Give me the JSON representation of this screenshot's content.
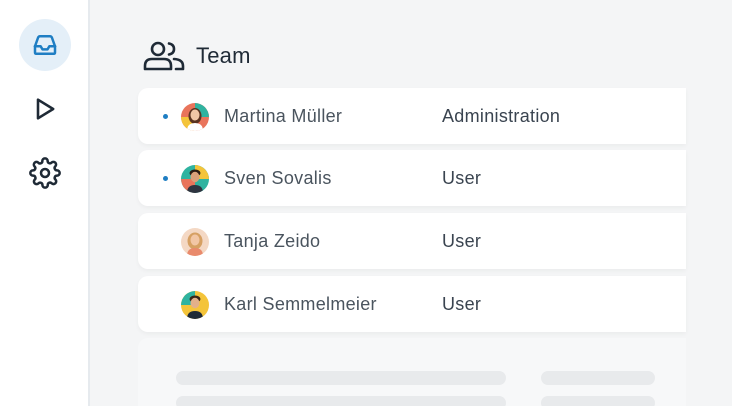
{
  "sidebar": {
    "items": [
      {
        "icon": "inbox-icon",
        "active": true
      },
      {
        "icon": "play-icon",
        "active": false
      },
      {
        "icon": "gear-icon",
        "active": false
      }
    ]
  },
  "header": {
    "title": "Team",
    "icon": "team-icon"
  },
  "members": [
    {
      "name": "Martina Müller",
      "role": "Administration",
      "unread": true
    },
    {
      "name": "Sven Sovalis",
      "role": "User",
      "unread": true
    },
    {
      "name": "Tanja Zeido",
      "role": "User",
      "unread": false
    },
    {
      "name": "Karl Semmelmeier",
      "role": "User",
      "unread": false
    }
  ],
  "colors": {
    "accent": "#1f7ec3",
    "active_bg": "#e4eff8",
    "text_dark": "#1f2a36"
  }
}
